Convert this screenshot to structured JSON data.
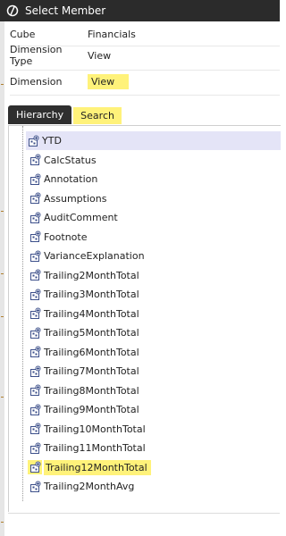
{
  "window": {
    "title": "Select Member"
  },
  "fields": {
    "cube_label": "Cube",
    "cube_value": "Financials",
    "dimtype_label": "Dimension Type",
    "dimtype_value": "View",
    "dim_label": "Dimension",
    "dim_value": "View"
  },
  "tabs": {
    "hierarchy": "Hierarchy",
    "search": "Search"
  },
  "tree": {
    "items": [
      "YTD",
      "CalcStatus",
      "Annotation",
      "Assumptions",
      "AuditComment",
      "Footnote",
      "VarianceExplanation",
      "Trailing2MonthTotal",
      "Trailing3MonthTotal",
      "Trailing4MonthTotal",
      "Trailing5MonthTotal",
      "Trailing6MonthTotal",
      "Trailing7MonthTotal",
      "Trailing8MonthTotal",
      "Trailing9MonthTotal",
      "Trailing10MonthTotal",
      "Trailing11MonthTotal",
      "Trailing12MonthTotal",
      "Trailing2MonthAvg"
    ],
    "selected_index": 0,
    "highlighted_index": 17
  },
  "colors": {
    "highlight": "#fff27a",
    "titlebar": "#2b2b2b",
    "selection": "#e4e4f7"
  }
}
